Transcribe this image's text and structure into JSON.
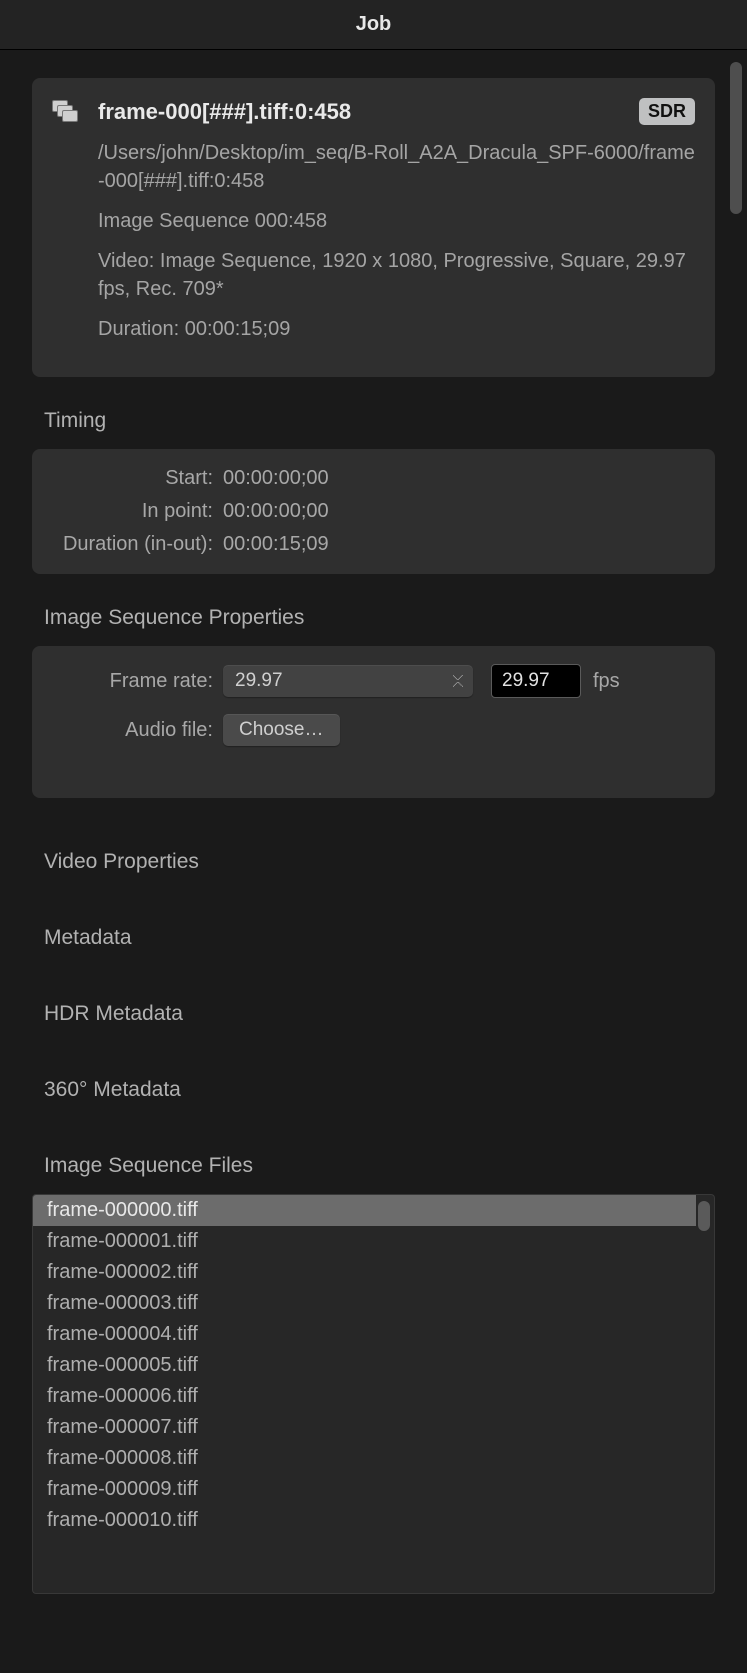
{
  "window": {
    "title": "Job"
  },
  "job": {
    "title": "frame-000[###].tiff:0:458",
    "badge": "SDR",
    "path": "/Users/john/Desktop/im_seq/B-Roll_A2A_Dracula_SPF-6000/frame-000[###].tiff:0:458",
    "sequence": "Image Sequence 000:458",
    "video_info": "Video: Image Sequence, 1920 x 1080, Progressive, Square, 29.97 fps, Rec. 709*",
    "duration": "Duration: 00:00:15;09"
  },
  "timing": {
    "heading": "Timing",
    "labels": {
      "start": "Start:",
      "in": "In point:",
      "duration": "Duration (in-out):"
    },
    "start": "00:00:00;00",
    "in_point": "00:00:00;00",
    "duration_in_out": "00:00:15;09"
  },
  "imgseq": {
    "heading": "Image Sequence Properties",
    "labels": {
      "frame_rate": "Frame rate:",
      "audio_file": "Audio file:"
    },
    "frame_rate_select": "29.97",
    "frame_rate_value": "29.97",
    "fps_unit": "fps",
    "choose_label": "Choose…"
  },
  "sections": {
    "video_props": "Video Properties",
    "metadata": "Metadata",
    "hdr_metadata": "HDR Metadata",
    "meta360": "360° Metadata",
    "files": "Image Sequence Files"
  },
  "files": [
    "frame-000000.tiff",
    "frame-000001.tiff",
    "frame-000002.tiff",
    "frame-000003.tiff",
    "frame-000004.tiff",
    "frame-000005.tiff",
    "frame-000006.tiff",
    "frame-000007.tiff",
    "frame-000008.tiff",
    "frame-000009.tiff",
    "frame-000010.tiff"
  ],
  "selected_file_index": 0
}
